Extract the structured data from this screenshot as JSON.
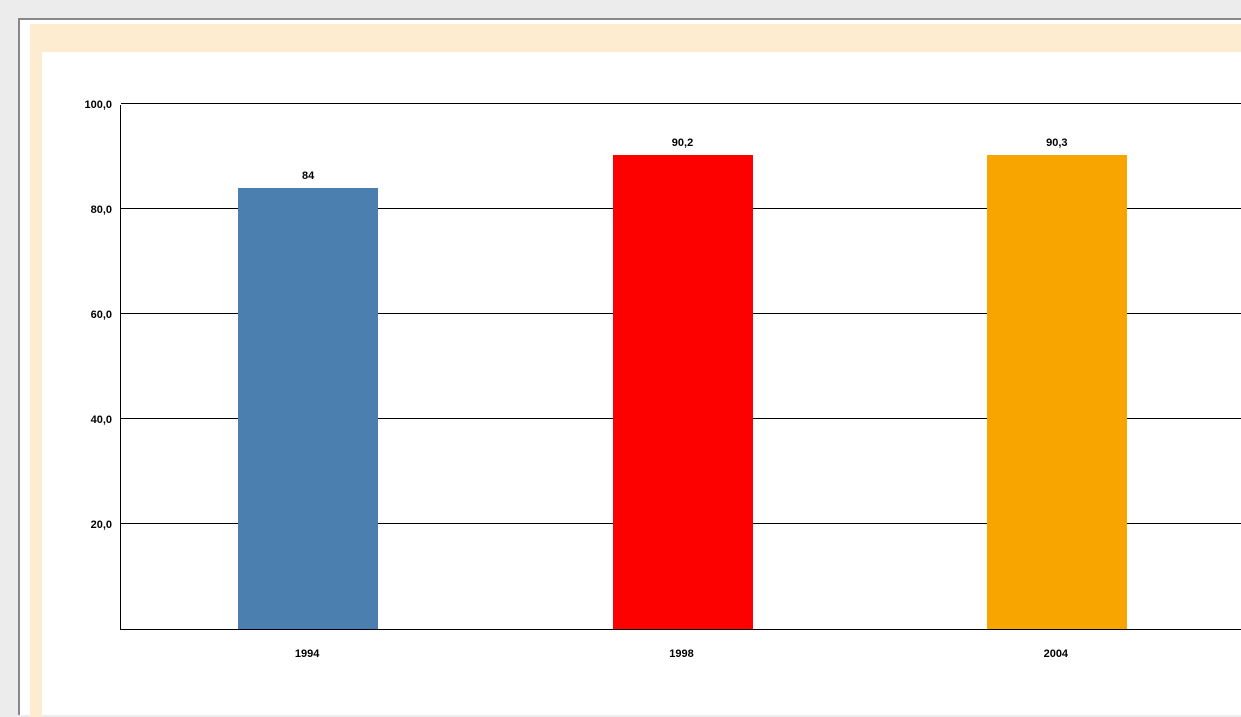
{
  "chart_data": {
    "type": "bar",
    "categories": [
      "1994",
      "1998",
      "2004"
    ],
    "values": [
      84,
      90.2,
      90.3
    ],
    "value_labels": [
      "84",
      "90,2",
      "90,3"
    ],
    "colors": [
      "#4a7fb0",
      "#fd0000",
      "#f9a500"
    ],
    "ylim": [
      0,
      100
    ],
    "yticks": [
      "20,0",
      "40,0",
      "60,0",
      "80,0",
      "100,0"
    ],
    "ytick_values": [
      20,
      40,
      60,
      80,
      100
    ],
    "title": "",
    "xlabel": "",
    "ylabel": ""
  }
}
